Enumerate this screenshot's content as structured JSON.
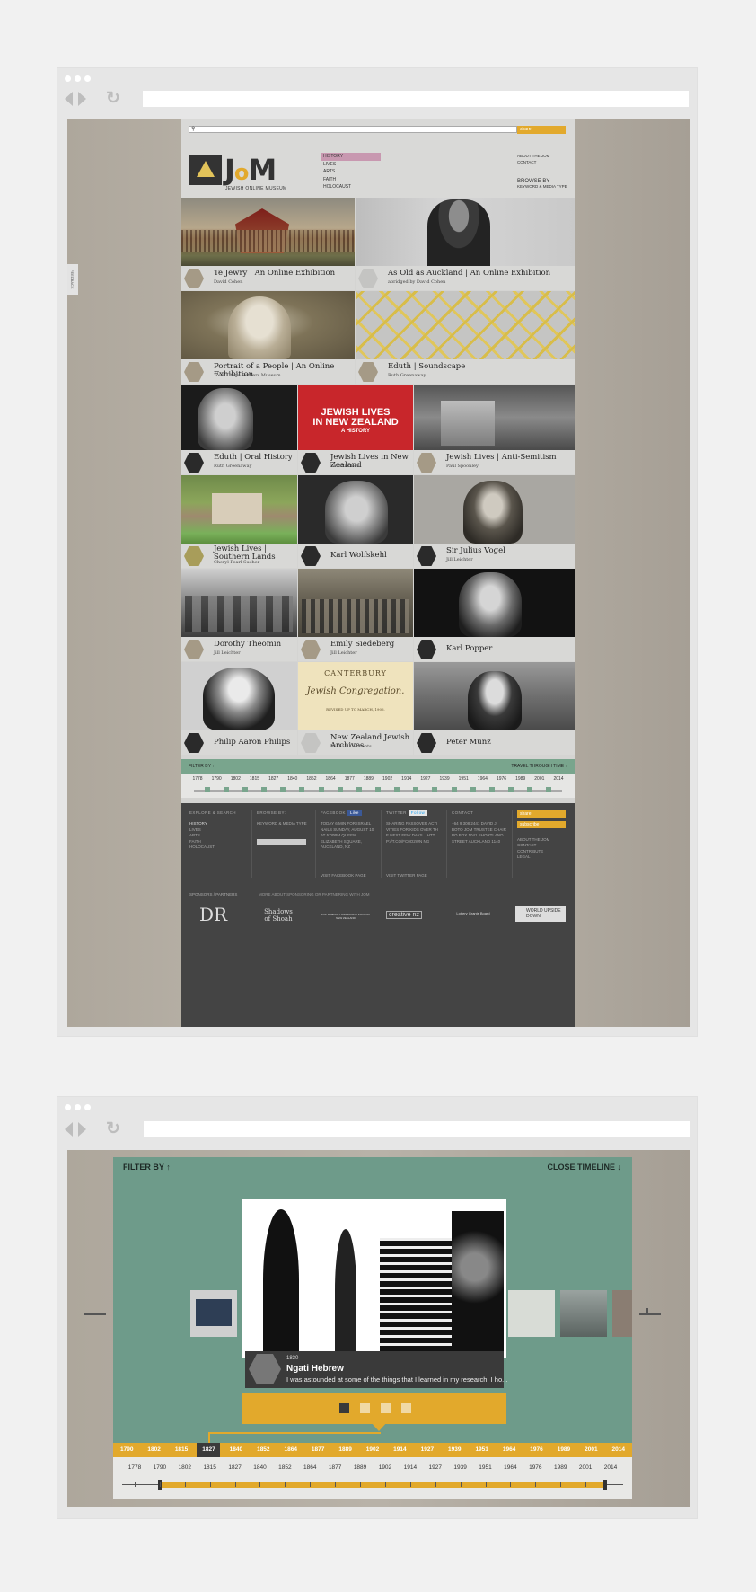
{
  "site": {
    "logo_text_j": "J",
    "logo_text_o": "o",
    "logo_text_m": "M",
    "logo_sub": "JEWISH ONLINE MUSEUM",
    "share_label": "share",
    "feedback_label": "FEEDBACK",
    "nav": [
      "HISTORY",
      "LIVES",
      "ARTS",
      "FAITH",
      "HOLOCAUST"
    ],
    "about": [
      "ABOUT THE JOM",
      "CONTACT"
    ],
    "browse_by": "BROWSE BY",
    "browse_by_sub": "KEYWORD & MEDIA TYPE"
  },
  "tiles": [
    {
      "title": "Te Jewry | An Online Exhibition",
      "sub": "David Cohen"
    },
    {
      "title": "As Old as Auckland | An Online Exhibition",
      "sub": "abridged by David Cohen"
    },
    {
      "title": "Portrait of a People | An Online Exhibition",
      "sub": "Toitū Otago Settlers Museum"
    },
    {
      "title": "Eduth | Soundscape",
      "sub": "Ruth Greenaway"
    },
    {
      "title": "Eduth | Oral History",
      "sub": "Ruth Greenaway"
    },
    {
      "title": "Jewish Lives in New Zealand",
      "sub": "Leonard Bell"
    },
    {
      "title": "Jewish Lives | Anti-Semitism",
      "sub": "Paul Spoonley"
    },
    {
      "title": "Jewish Lives | Southern Lands",
      "sub": "Cheryl Pearl Sucher"
    },
    {
      "title": "Karl Wolfskehl",
      "sub": ""
    },
    {
      "title": "Sir Julius Vogel",
      "sub": "Jill Leichter"
    },
    {
      "title": "Dorothy Theomin",
      "sub": "Jill Leichter"
    },
    {
      "title": "Emily Siedeberg",
      "sub": "Jill Leichter"
    },
    {
      "title": "Karl Popper",
      "sub": ""
    },
    {
      "title": "Philip Aaron Philips",
      "sub": ""
    },
    {
      "title": "New Zealand Jewish Archives",
      "sub": "Michael Clements"
    },
    {
      "title": "Peter Munz",
      "sub": ""
    }
  ],
  "book_cover": {
    "line1": "JEWISH LIVES",
    "line2": "IN NEW ZEALAND",
    "line3": "A HISTORY"
  },
  "congregation": {
    "line1": "CANTERBURY",
    "line2": "Jewish Congregation.",
    "line3": "REVISED UP TO MARCH, 1906."
  },
  "filter": {
    "filter_by": "FILTER BY",
    "travel": "TRAVEL THROUGH TIME"
  },
  "years_small": [
    "1778",
    "1790",
    "1802",
    "1815",
    "1827",
    "1840",
    "1852",
    "1864",
    "1877",
    "1889",
    "1902",
    "1914",
    "1927",
    "1939",
    "1951",
    "1964",
    "1976",
    "1989",
    "2001",
    "2014"
  ],
  "footer": {
    "explore": "EXPLORE & SEARCH",
    "explore_items": [
      "HISTORY",
      "LIVES",
      "ARTS",
      "FAITH",
      "HOLOCAUST"
    ],
    "browse": "BROWSE BY:",
    "browse_sub": "KEYWORD & MEDIA TYPE",
    "facebook": "FACEBOOK",
    "like": "Like",
    "fb_text": "TODAY 6 MIN FOR ISRAEL NAILS SUNDAY, AUGUST 10 AT 5:00PM QUEEN ELIZABETH SQUARE, AUCKLAND, NZ",
    "fb_link": "VISIT FACEBOOK PAGE",
    "twitter": "TWITTER",
    "follow": "Follow",
    "tw_text": "SHARING PASSOVER ACTIVITIES FOR KIDS OVER THE NEXT FEW DAYS... HTTP://T.CO/FC0O2WN NG",
    "tw_link": "VISIT TWITTER PAGE",
    "contact": "CONTACT",
    "contact_text": "+64 9 308 2441 DAVID J BOTO JOM TRUSTEE CHAIR PO BOX 1041 SHORTLAND STREET AUCKLAND 1140",
    "share": "share",
    "subscribe": "subscribe",
    "links": [
      "ABOUT THE JOM",
      "CONTACT",
      "CONTRIBUTE",
      "LEGAL"
    ],
    "sponsors": "SPONSORS / PARTNERS",
    "sponsors_more": "MORE ABOUT SPONSORING OR PARTNERING WITH JOM",
    "sponsor_logos": [
      "DR",
      "Shadows of Shoah",
      "THE ROBERT LOWENSTEIN SOCIETY NEW ZEALAND",
      "creative nz",
      "Lottery Grants Board",
      "WORLD UPSIDE DOWN"
    ]
  },
  "timeline": {
    "filter_by": "FILTER BY",
    "close": "CLOSE TIMELINE",
    "slide_year": "1830",
    "slide_name": "Ngati Hebrew",
    "slide_desc": "I was astounded at some of the things that I learned in my research: I ho...",
    "band_years": [
      "1790",
      "1802",
      "1815",
      "1827",
      "1840",
      "1852",
      "1864",
      "1877",
      "1889",
      "1902",
      "1914",
      "1927",
      "1939",
      "1951",
      "1964",
      "1976",
      "1989",
      "2001",
      "2014"
    ],
    "selected_year": "1827",
    "track_years": [
      "1778",
      "1790",
      "1802",
      "1815",
      "1827",
      "1840",
      "1852",
      "1864",
      "1877",
      "1889",
      "1902",
      "1914",
      "1927",
      "1939",
      "1951",
      "1964",
      "1976",
      "1989",
      "2001",
      "2014"
    ],
    "slide_count": 4,
    "active_slide": 1
  },
  "colors": {
    "accent": "#e2a92c",
    "teal": "#6e9b8a",
    "nav_active": "#c898b0",
    "footer": "#444444"
  }
}
